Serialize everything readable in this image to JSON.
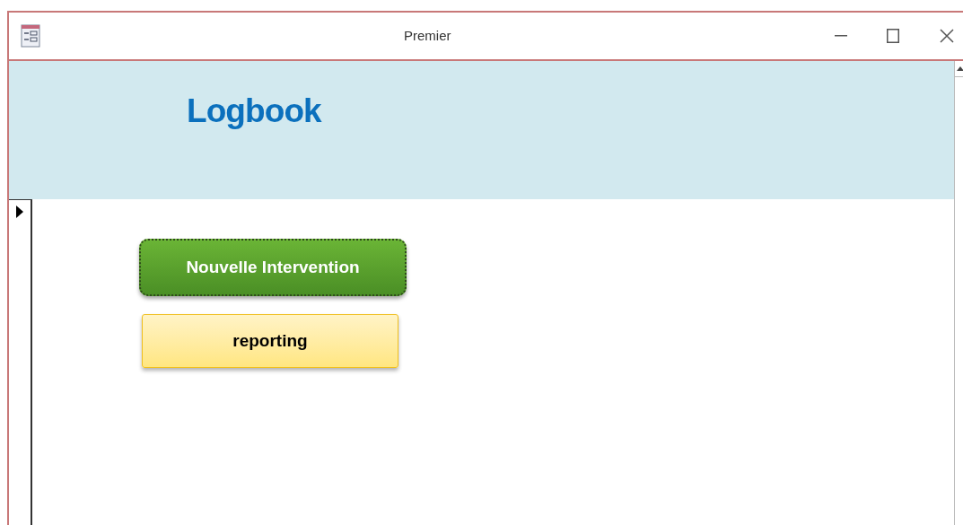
{
  "window": {
    "title": "Premier"
  },
  "header": {
    "title": "Logbook"
  },
  "buttons": [
    {
      "label": "Nouvelle Intervention",
      "kind": "primary",
      "focused": true
    },
    {
      "label": "reporting",
      "kind": "secondary",
      "focused": false
    }
  ]
}
